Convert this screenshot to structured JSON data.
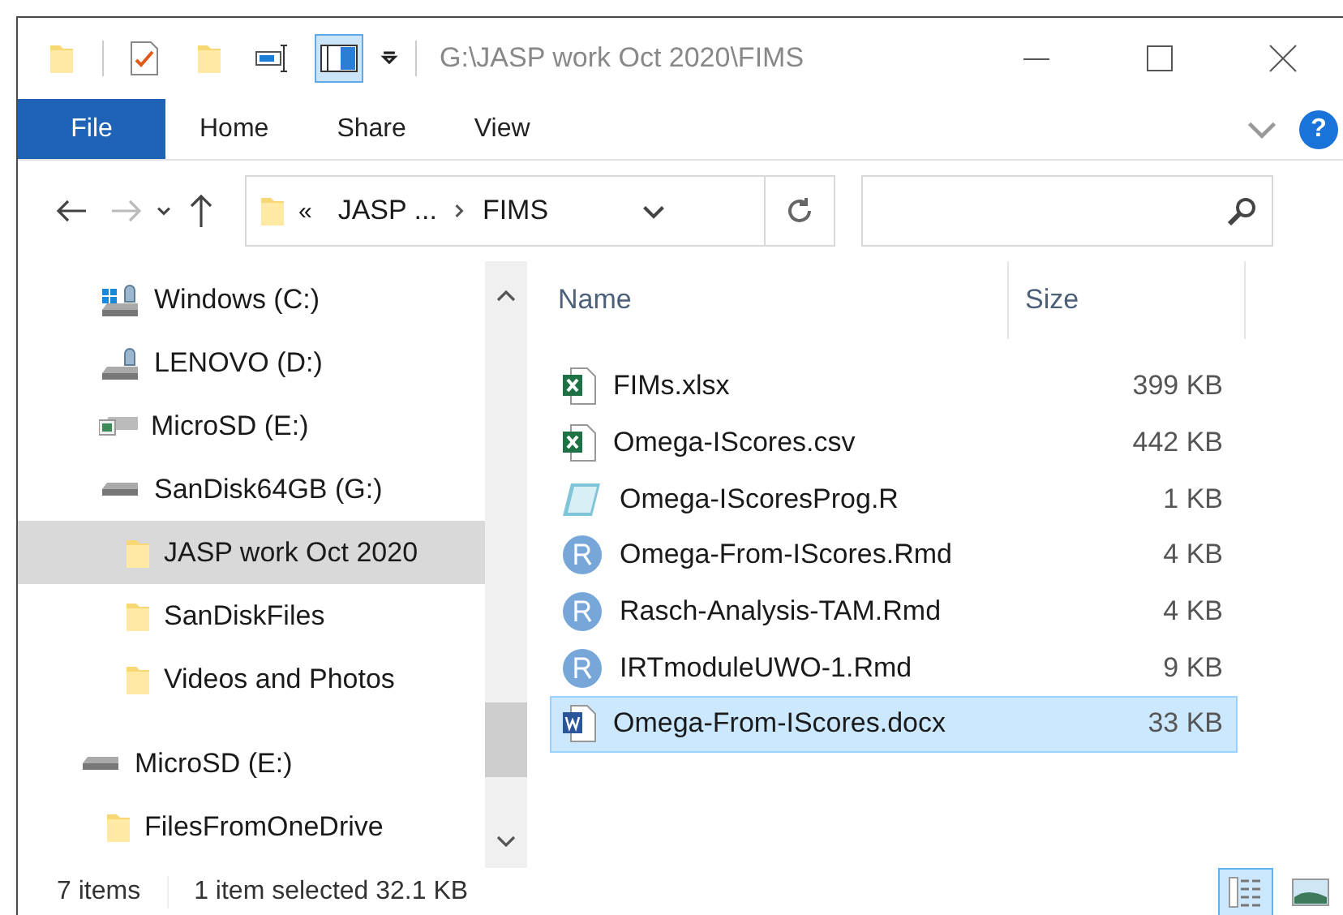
{
  "window": {
    "title": "G:\\JASP work Oct 2020\\FIMS"
  },
  "quick_access": [
    {
      "kind": "folder",
      "selected": false
    },
    {
      "kind": "properties",
      "selected": false
    },
    {
      "kind": "newfolder",
      "selected": false
    },
    {
      "kind": "rename",
      "selected": false
    },
    {
      "kind": "pane",
      "selected": true
    }
  ],
  "ribbon": {
    "tabs": [
      {
        "label": "File",
        "selected": true
      },
      {
        "label": "Home",
        "selected": false
      },
      {
        "label": "Share",
        "selected": false
      },
      {
        "label": "View",
        "selected": false
      }
    ],
    "help": "?"
  },
  "address": {
    "overflow": "«",
    "crumbs": [
      "JASP ...",
      "FIMS"
    ]
  },
  "nav": {
    "groups": [
      {
        "items": [
          {
            "label": "Windows (C:)",
            "kind": "system"
          },
          {
            "label": "LENOVO (D:)",
            "kind": "drive-lock"
          },
          {
            "label": "MicroSD (E:)",
            "kind": "card"
          },
          {
            "label": "SanDisk64GB (G:)",
            "kind": "drive",
            "children": [
              {
                "label": "JASP work Oct 2020",
                "kind": "folder",
                "selected": true
              },
              {
                "label": "SanDiskFiles",
                "kind": "folder",
                "selected": false
              },
              {
                "label": "Videos and Photos",
                "kind": "folder",
                "selected": false
              }
            ]
          }
        ]
      },
      {
        "items": [
          {
            "label": "MicroSD (E:)",
            "kind": "drive",
            "children": [
              {
                "label": "FilesFromOneDrive",
                "kind": "folder",
                "selected": false
              }
            ]
          }
        ]
      }
    ]
  },
  "files": {
    "columns": [
      "Name",
      "Size"
    ],
    "rows": [
      {
        "name": "FIMs.xlsx",
        "size": "399 KB",
        "kind": "excel",
        "selected": false
      },
      {
        "name": "Omega-IScores.csv",
        "size": "442 KB",
        "kind": "csv",
        "selected": false
      },
      {
        "name": "Omega-IScoresProg.R",
        "size": "1 KB",
        "kind": "notepad",
        "selected": false
      },
      {
        "name": "Omega-From-IScores.Rmd",
        "size": "4 KB",
        "kind": "r",
        "selected": false
      },
      {
        "name": "Rasch-Analysis-TAM.Rmd",
        "size": "4 KB",
        "kind": "r",
        "selected": false
      },
      {
        "name": "IRTmoduleUWO-1.Rmd",
        "size": "9 KB",
        "kind": "r",
        "selected": false
      },
      {
        "name": "Omega-From-IScores.docx",
        "size": "33 KB",
        "kind": "word",
        "selected": true
      }
    ]
  },
  "status_bar": {
    "count": "7 items",
    "selection": "1 item selected  32.1 KB",
    "views": [
      {
        "kind": "details",
        "selected": true
      },
      {
        "kind": "large",
        "selected": false
      }
    ]
  }
}
